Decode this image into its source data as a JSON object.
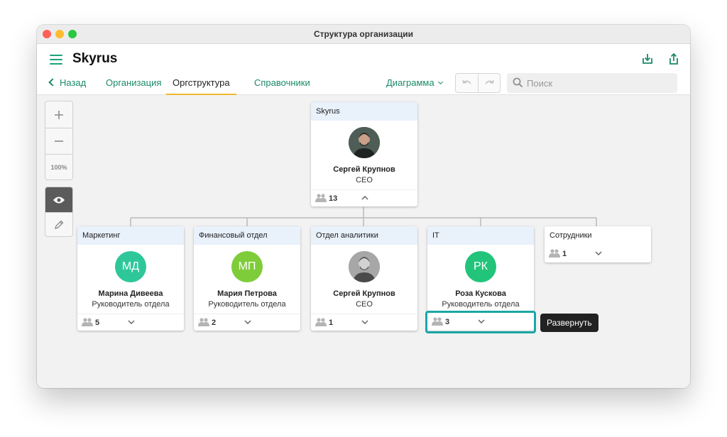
{
  "window": {
    "title": "Структура организации"
  },
  "header": {
    "app_title": "Skyrus",
    "download_icon": "download-icon",
    "share_icon": "share-icon"
  },
  "nav": {
    "back_label": "Назад",
    "tabs": [
      {
        "label": "Организация",
        "active": false
      },
      {
        "label": "Оргструктура",
        "active": true
      },
      {
        "label": "Справочники",
        "active": false
      }
    ],
    "view_mode": "Диаграмма",
    "search_placeholder": "Поиск"
  },
  "zoom": {
    "level_label": "100%"
  },
  "root": {
    "department": "Skyrus",
    "name": "Сергей Крупнов",
    "role": "CEO",
    "count": "13"
  },
  "departments": [
    {
      "department": "Маркетинг",
      "initials": "МД",
      "avatar_color": "#2ec79a",
      "name": "Марина Дивеева",
      "role": "Руководитель отдела",
      "count": "5"
    },
    {
      "department": "Финансовый отдел",
      "initials": "МП",
      "avatar_color": "#7fcc3a",
      "name": "Мария Петрова",
      "role": "Руководитель отдела",
      "count": "2"
    },
    {
      "department": "Отдел аналитики",
      "initials": "",
      "avatar_color": "#9a9a9a",
      "name": "Сергей Крупнов",
      "role": "CEO",
      "count": "1"
    },
    {
      "department": "IT",
      "initials": "РК",
      "avatar_color": "#22c47a",
      "name": "Роза Кускова",
      "role": "Руководитель отдела",
      "count": "3"
    },
    {
      "department": "Сотрудники",
      "count": "1"
    }
  ],
  "tooltip": {
    "text": "Развернуть"
  },
  "colors": {
    "accent": "#1a8a68",
    "tab_underline": "#f0b830",
    "highlight": "#1aa7a7",
    "card_header": "#e9f1fb"
  }
}
